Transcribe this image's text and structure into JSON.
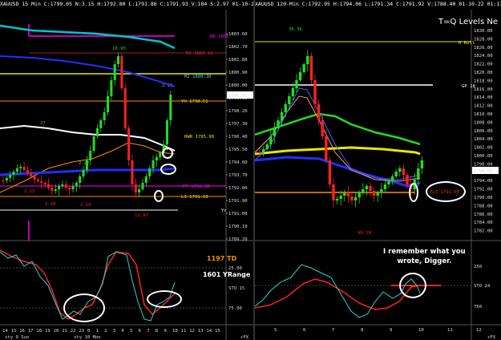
{
  "left": {
    "header": "XAUUSD 15 Min C:1799.05 N:3.15 H:1792.80 L:1791.86 C:1791.93 V:184 S:2.97 01-10-22 2:17",
    "price_tag": "1799.05",
    "y_ticks": [
      "1803.60",
      "1802.70",
      "1801.80",
      "1800.90",
      "1800.00",
      "1799.10",
      "1798.20",
      "1797.30",
      "1796.40",
      "1795.50",
      "1794.60",
      "1793.70",
      "1792.80",
      "1791.90",
      "1791.00",
      "1790.10",
      "1789.20"
    ],
    "x_ticks": [
      "14",
      "15",
      "16",
      "17",
      "18",
      "19",
      "20",
      "21",
      "22",
      "23",
      "0",
      "1",
      "2",
      "3",
      "4",
      "5",
      "6",
      "7",
      "8",
      "9",
      "10",
      "11",
      "12",
      "13",
      "14",
      "15"
    ],
    "date_labels": [
      "sty 9 Sun",
      "sty 10 Mon"
    ],
    "level_labels": {
      "we": "WE 1805",
      "r1": "R1 1802.11",
      "r10": "10.95",
      "m2": "M2 1800.30",
      "r2n": "2.11",
      "yh": "YH 1798.51",
      "rwr": "RWR 1795.90",
      "n37": "37",
      "n227": "2.27",
      "n225": "2.25",
      "pp": "PP 1792.30",
      "l3": "L3 1791.50",
      "n320": "3.20",
      "n210": "2.10",
      "n1197": "11.97",
      "yr": "Yr"
    },
    "sto_ticks": [
      "25.00",
      "75.00"
    ],
    "sto_label": "STO",
    "sto_value": "15",
    "td_text": "1197 TD",
    "yrange_text": "1601 YRange",
    "cursor_mark": "+FX"
  },
  "right": {
    "header": "XAUUSD 120-Min C:1792.95 H:1794.06 L:1791.34 C:1791.92 V:1788.40 01-10-22 01:17:17",
    "title": "T=Q Levels Ne",
    "price_tag": "1799.05",
    "y_ticks": [
      "1830.00",
      "1828.00",
      "1826.00",
      "1824.00",
      "1822.00",
      "1820.00",
      "1818.00",
      "1816.00",
      "1814.00",
      "1812.00",
      "1810.00",
      "1808.00",
      "1806.00",
      "1804.00",
      "1802.00",
      "1800.00",
      "1798.00",
      "1796.00",
      "1794.00",
      "1792.00",
      "1790.00",
      "1788.00",
      "1786.00",
      "1784.00",
      "1782.00"
    ],
    "x_ticks": [
      "5",
      "6",
      "7",
      "8",
      "9",
      "10",
      "11",
      "12"
    ],
    "level_labels": {
      "top": "30.36",
      "roll": "0 Roll",
      "gp": "GP 18",
      "pl": "PL3 1791.00",
      "low": "40.18"
    },
    "sto_ticks": [
      "250",
      "750"
    ],
    "sto_label": "STO",
    "sto_value": "24",
    "note": "I remember what you wrote, Digger.",
    "note_line1": "I remember what you",
    "note_line2": "wrote, Digger.",
    "cursor_mark": "+FX"
  },
  "colors": {
    "magenta": "#ff00ff",
    "cyan": "#00c8c8",
    "yellow": "#e8e800",
    "blue": "#2030ff",
    "green": "#22dd22",
    "red": "#ff2020",
    "orange": "#ff8c00",
    "white": "#ffffff",
    "salmon": "#ff9080"
  }
}
